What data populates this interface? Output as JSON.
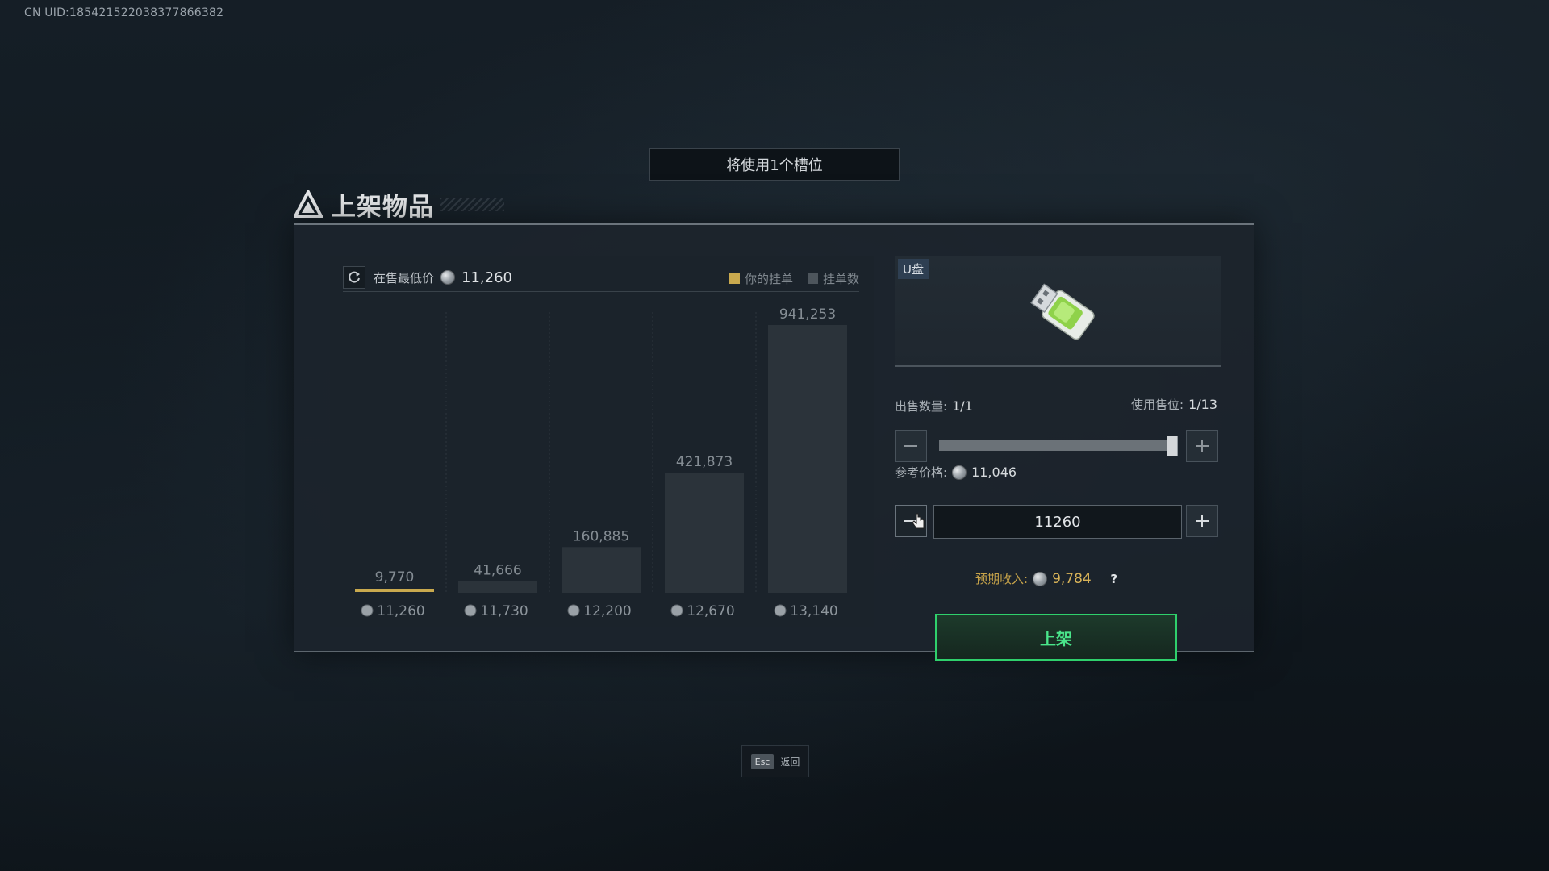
{
  "uid": "CN UID:18542152203837786638​2",
  "slot_banner": "将使用1个槽位",
  "title": "上架物品",
  "chart_header": {
    "lowest_label": "在售最低价",
    "lowest_value": "11,260"
  },
  "legend": {
    "yours": "你的挂单",
    "count": "挂单数",
    "yours_color": "#c9a94e",
    "count_color": "#4d555c"
  },
  "chart_data": {
    "type": "bar",
    "categories": [
      "11,260",
      "11,730",
      "12,200",
      "12,670",
      "13,140"
    ],
    "values": [
      9770,
      41666,
      160885,
      421873,
      941253
    ],
    "value_labels": [
      "9,770",
      "41,666",
      "160,885",
      "421,873",
      "941,253"
    ],
    "ylim": [
      0,
      941253
    ],
    "highlight_index": 0
  },
  "item": {
    "name": "U盘",
    "icon": "usb-drive-icon"
  },
  "sell_qty": {
    "label": "出售数量:",
    "value": "1/1"
  },
  "slots_used": {
    "label": "使用售位:",
    "value": "1/13"
  },
  "slider_level": 1.0,
  "ref_price": {
    "label": "参考价格:",
    "value": "11,046"
  },
  "price_input_value": "11260",
  "income": {
    "label": "预期收入:",
    "value": "9,784",
    "help": "?"
  },
  "list_button": "上架",
  "esc": {
    "key": "Esc",
    "label": "返回"
  },
  "colors": {
    "accent_green": "#2fd06c",
    "gold": "#c9a94e"
  }
}
